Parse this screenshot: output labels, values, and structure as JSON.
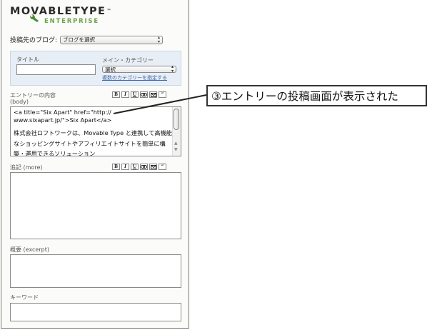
{
  "brand": {
    "logo_text": "MOVABLETYPE",
    "logo_tm": "™",
    "logo_sub": "ENTERPRISE"
  },
  "blog": {
    "label": "投稿先のブログ:",
    "select_value": "ブログを選択"
  },
  "entry_meta": {
    "title_label": "タイトル",
    "title_value": "",
    "category_label": "メイン・カテゴリー",
    "category_value": "選択",
    "multi_category_link": "複数のカテゴリーを指定する"
  },
  "toolbar_icons": [
    "bold-icon",
    "italic-icon",
    "underline-icon",
    "link-icon",
    "email-icon",
    "quote-icon"
  ],
  "toolbar_labels": {
    "bold": "B",
    "italic": "I",
    "underline": "U",
    "quote": "“"
  },
  "body": {
    "label_line1": "エントリーの内容",
    "label_line2": "(body)",
    "content_line1": "<a title=\"Six Apart\" href=\"http://\nwww.sixapart.jp/\">Six Apart</a>",
    "content_line2": "株式会社ロフトワークは、Movable Type と連携して高機能なショッピングサイトやアフィリエイトサイトを簡単に構築・運用できるソリューション"
  },
  "more": {
    "label": "追記 (more)",
    "value": ""
  },
  "excerpt": {
    "label": "概要 (excerpt)",
    "value": ""
  },
  "keywords": {
    "label": "キーワード",
    "value": ""
  },
  "callout": {
    "text": "③エントリーの投稿画面が表示された"
  }
}
